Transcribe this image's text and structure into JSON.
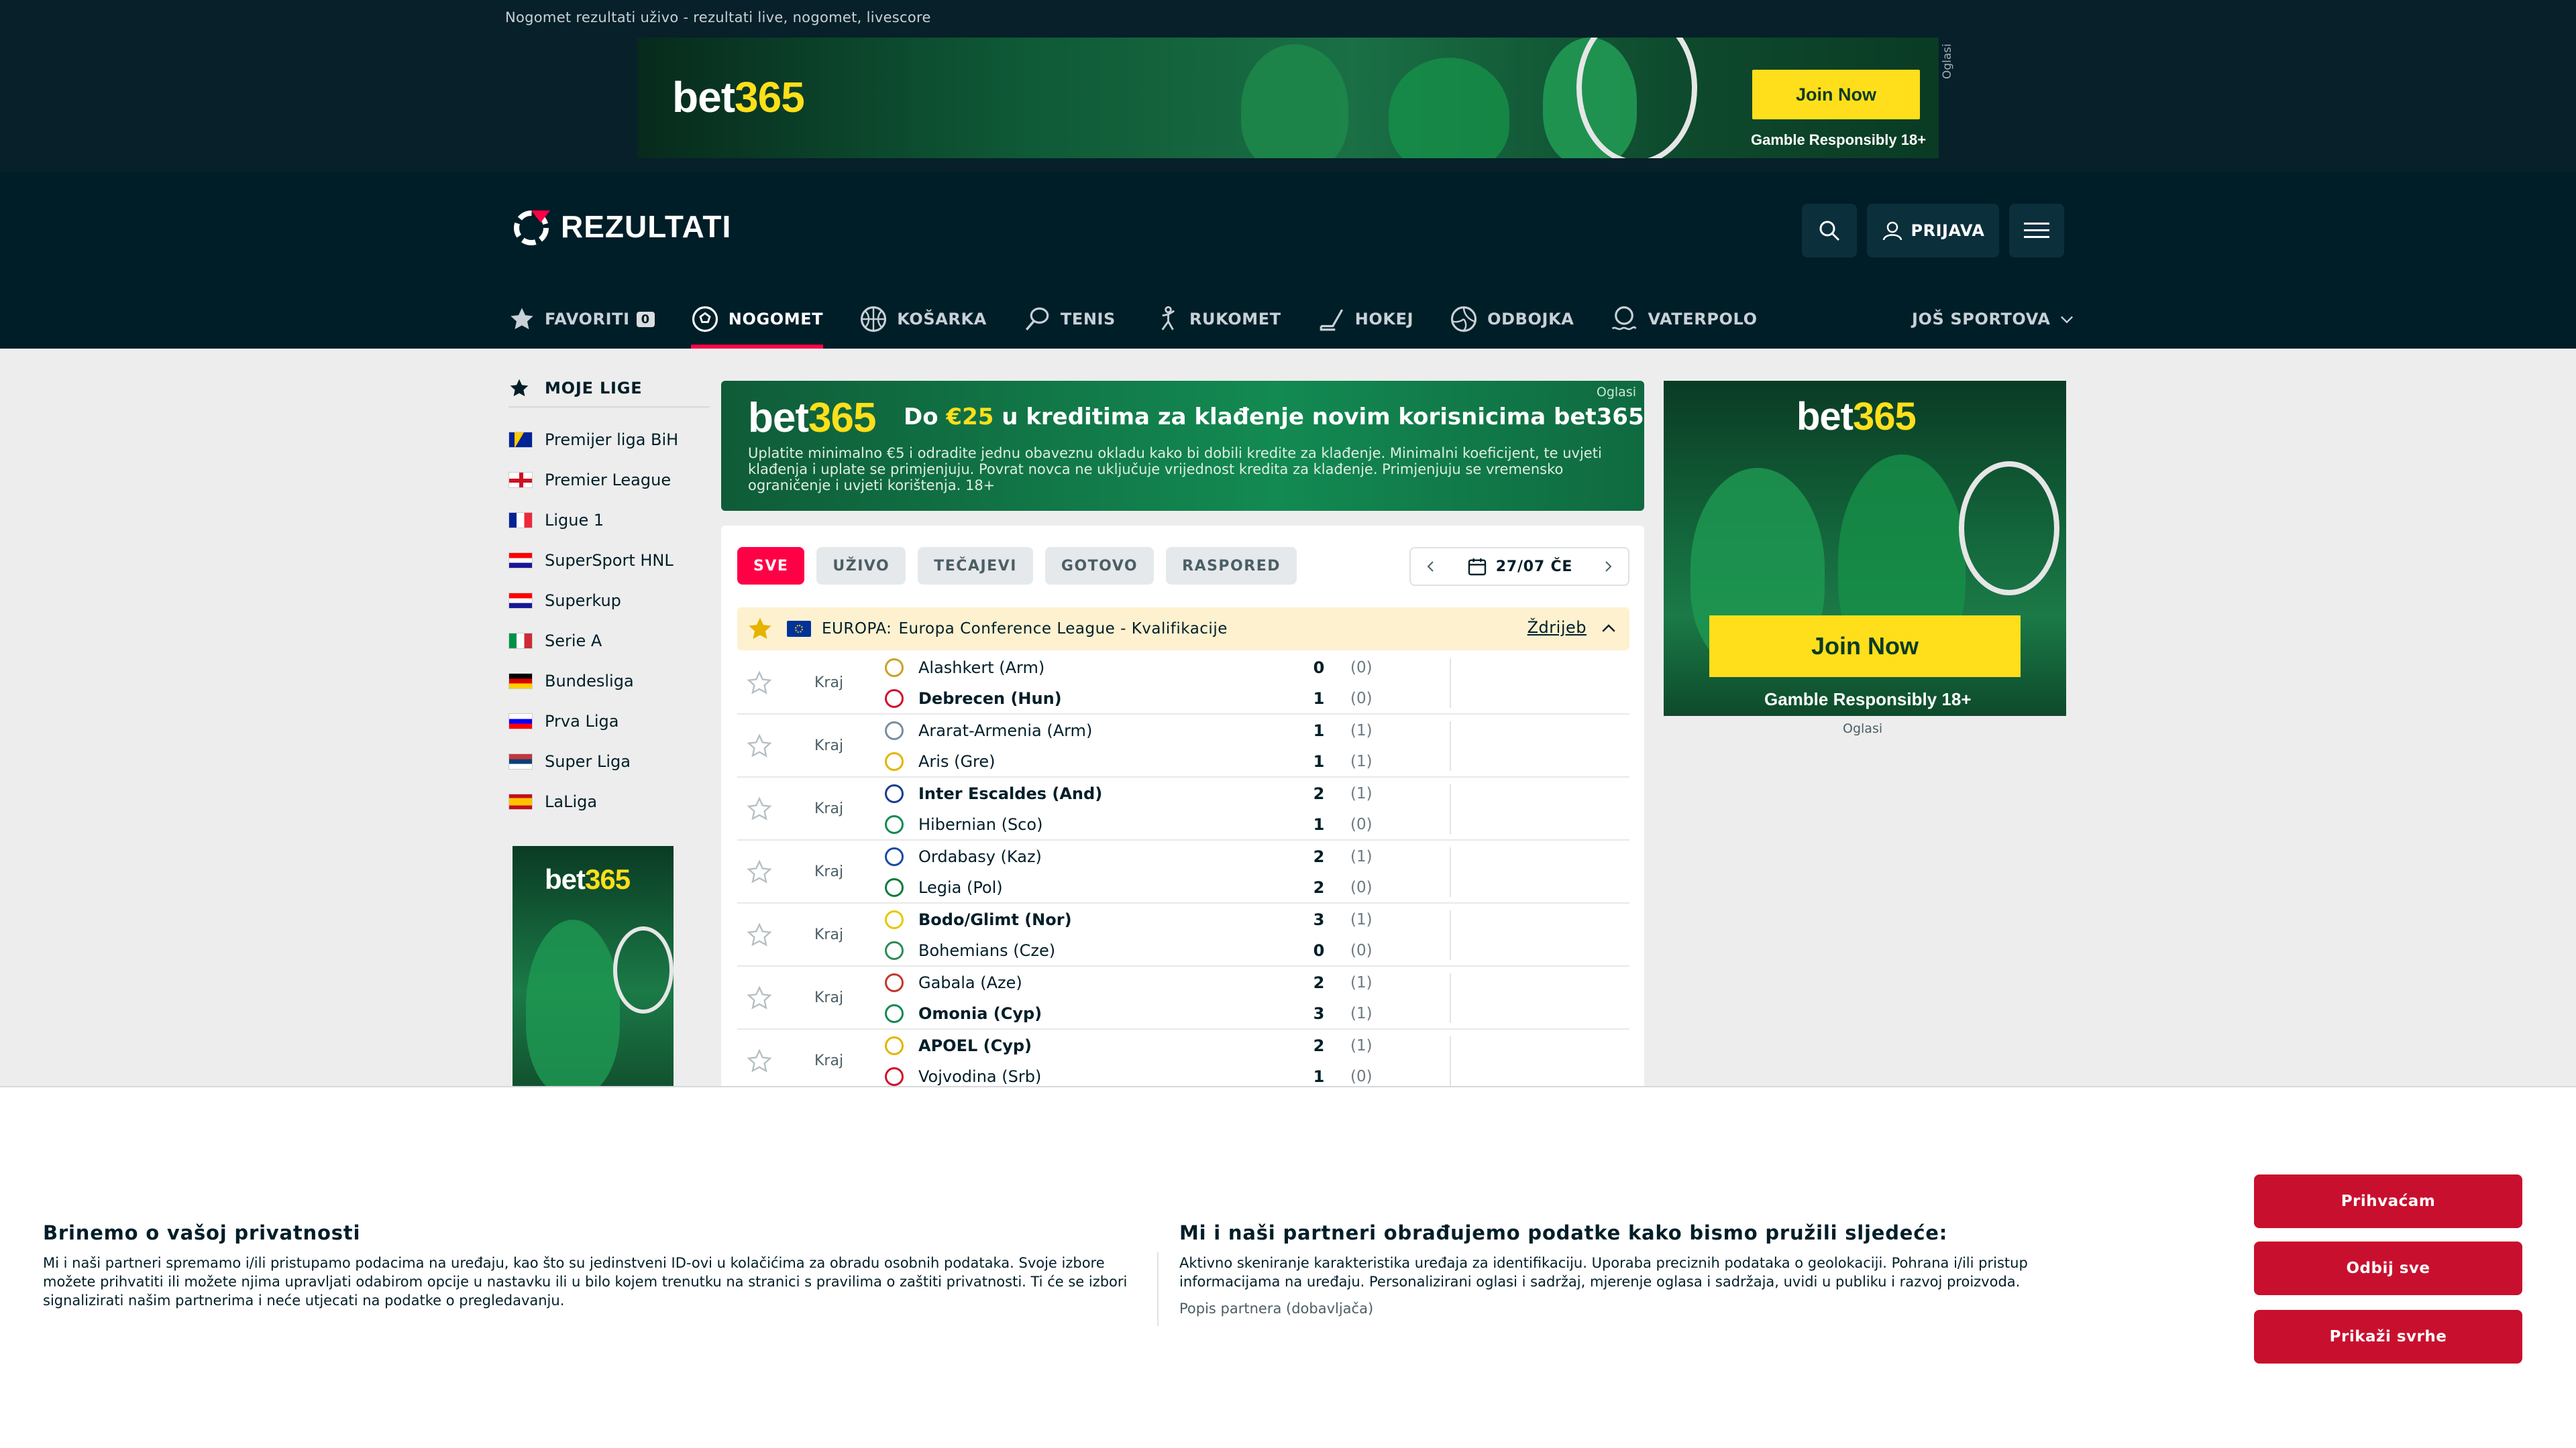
{
  "page": {
    "seo_title": "Nogomet rezultati uživo - rezultati live, nogomet, livescore"
  },
  "top_ad": {
    "logo_a": "bet",
    "logo_b": "365",
    "join": "Join Now",
    "gamble": "Gamble Responsibly  18+",
    "label": "Oglasi"
  },
  "header": {
    "logo": "REZULTATI",
    "login": "PRIJAVA"
  },
  "nav": {
    "items": [
      {
        "label": "FAVORITI",
        "badge": "0",
        "icon": "star-icon"
      },
      {
        "label": "NOGOMET",
        "icon": "football-icon",
        "active": true
      },
      {
        "label": "KOŠARKA",
        "icon": "basketball-icon"
      },
      {
        "label": "TENIS",
        "icon": "tennis-icon"
      },
      {
        "label": "RUKOMET",
        "icon": "handball-icon"
      },
      {
        "label": "HOKEJ",
        "icon": "hockey-icon"
      },
      {
        "label": "ODBOJKA",
        "icon": "volleyball-icon"
      },
      {
        "label": "VATERPOLO",
        "icon": "waterpolo-icon"
      }
    ],
    "more": "JOŠ SPORTOVA"
  },
  "sidebar": {
    "title": "MOJE LIGE",
    "leagues": [
      {
        "name": "Premijer liga BiH",
        "flag": "ba"
      },
      {
        "name": "Premier League",
        "flag": "en"
      },
      {
        "name": "Ligue 1",
        "flag": "fr"
      },
      {
        "name": "SuperSport HNL",
        "flag": "hr"
      },
      {
        "name": "Superkup",
        "flag": "hr"
      },
      {
        "name": "Serie A",
        "flag": "it"
      },
      {
        "name": "Bundesliga",
        "flag": "de"
      },
      {
        "name": "Prva Liga",
        "flag": "si"
      },
      {
        "name": "Super Liga",
        "flag": "rs"
      },
      {
        "name": "LaLiga",
        "flag": "es"
      }
    ],
    "ad_logo_a": "bet",
    "ad_logo_b": "365"
  },
  "promo": {
    "logo_a": "bet",
    "logo_b": "365",
    "title_pre": "Do ",
    "title_amount": "€25",
    "title_post": " u kreditima za klađenje novim korisnicima bet365",
    "text": "Uplatite minimalno €5 i odradite jednu obaveznu okladu kako bi dobili kredite za klađenje. Minimalni koeficijent, te uvjeti klađenja i uplate se primjenjuju. Povrat novca ne uključuje vrijednost kredita za klađenje. Primjenjuju se vremensko ograničenje i uvjeti korištenja. 18+",
    "label": "Oglasi"
  },
  "filters": [
    "SVE",
    "UŽIVO",
    "TEČAJEVI",
    "GOTOVO",
    "RASPORED"
  ],
  "date": "27/07 ČE",
  "league_header": {
    "country": "EUROPA:",
    "name": "Europa Conference League - Kvalifikacije",
    "draw": "Ždrijeb"
  },
  "matches": [
    {
      "status": "Kraj",
      "home": "Alashkert (Arm)",
      "away": "Debrecen (Hun)",
      "hs": "0",
      "as": "1",
      "hh": "(0)",
      "ah": "(0)",
      "winner": "away",
      "hc": "#c9a227",
      "ac": "#d0102a"
    },
    {
      "status": "Kraj",
      "home": "Ararat-Armenia (Arm)",
      "away": "Aris (Gre)",
      "hs": "1",
      "as": "1",
      "hh": "(1)",
      "ah": "(1)",
      "winner": "",
      "hc": "#7a8ea0",
      "ac": "#e4b400"
    },
    {
      "status": "Kraj",
      "home": "Inter Escaldes (And)",
      "away": "Hibernian (Sco)",
      "hs": "2",
      "as": "1",
      "hh": "(1)",
      "ah": "(0)",
      "winner": "home",
      "hc": "#1a3d8f",
      "ac": "#138a52"
    },
    {
      "status": "Kraj",
      "home": "Ordabasy (Kaz)",
      "away": "Legia (Pol)",
      "hs": "2",
      "as": "2",
      "hh": "(1)",
      "ah": "(0)",
      "winner": "",
      "hc": "#1a4aa8",
      "ac": "#0e7a3c"
    },
    {
      "status": "Kraj",
      "home": "Bodo/Glimt (Nor)",
      "away": "Bohemians (Cze)",
      "hs": "3",
      "as": "0",
      "hh": "(1)",
      "ah": "(0)",
      "winner": "home",
      "hc": "#e8c700",
      "ac": "#2e8b57"
    },
    {
      "status": "Kraj",
      "home": "Gabala (Aze)",
      "away": "Omonia (Cyp)",
      "hs": "2",
      "as": "3",
      "hh": "(1)",
      "ah": "(1)",
      "winner": "away",
      "hc": "#c0392b",
      "ac": "#138a52"
    },
    {
      "status": "Kraj",
      "home": "APOEL (Cyp)",
      "away": "Vojvodina (Srb)",
      "hs": "2",
      "as": "1",
      "hh": "(1)",
      "ah": "(0)",
      "winner": "home",
      "hc": "#e4b400",
      "ac": "#d0102a"
    }
  ],
  "right_ad": {
    "logo_a": "bet",
    "logo_b": "365",
    "join": "Join Now",
    "gamble": "Gamble Responsibly  18+",
    "label": "Oglasi"
  },
  "consent": {
    "left_title": "Brinemo o vašoj privatnosti",
    "left_text": "Mi i naši partneri spremamo i/ili pristupamo podacima na uređaju, kao što su jedinstveni ID-ovi u kolačićima za obradu osobnih podataka. Svoje izbore možete prihvatiti ili možete njima upravljati odabirom opcije u nastavku ili u bilo kojem trenutku na stranici s pravilima o zaštiti privatnosti. Ti će se izbori signalizirati našim partnerima i neće utjecati na podatke o pregledavanju.",
    "mid_title": "Mi i naši partneri obrađujemo podatke kako bismo pružili sljedeće:",
    "mid_text": "Aktivno skeniranje karakteristika uređaja za identifikaciju. Uporaba preciznih podataka o geolokaciji. Pohrana i/ili pristup informacijama na uređaju. Personalizirani oglasi i sadržaj, mjerenje oglasa i sadržaja, uvidi u publiku i razvoj proizvoda.",
    "partners": "Popis partnera (dobavljača)",
    "accept": "Prihvaćam",
    "reject": "Odbij sve",
    "purposes": "Prikaži svrhe"
  },
  "colors": {
    "accent": "#ff0046",
    "header_bg": "#001e28",
    "consent_btn": "#c8102e",
    "bet365_yellow": "#ffdf1b"
  }
}
